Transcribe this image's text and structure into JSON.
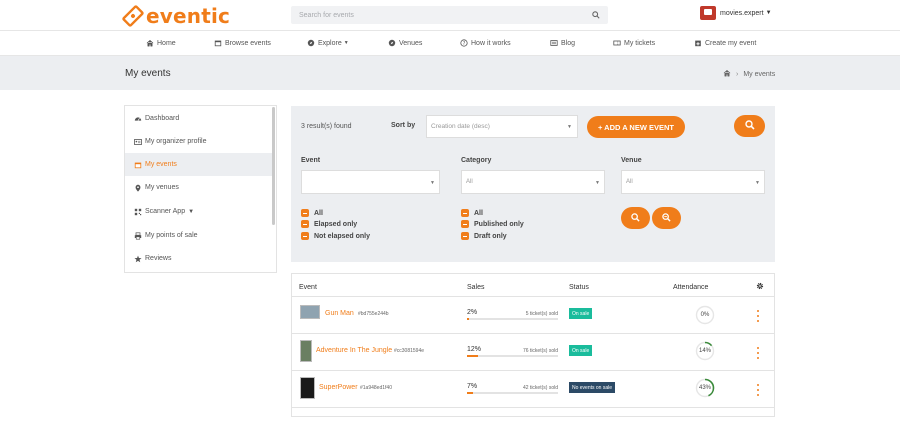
{
  "header": {
    "logo_text": "eventic",
    "search_placeholder": "Search for events",
    "user_name": "movies.expert"
  },
  "nav": [
    {
      "label": "Home",
      "icon": "home-icon"
    },
    {
      "label": "Browse events",
      "icon": "calendar-icon"
    },
    {
      "label": "Explore",
      "icon": "compass-icon"
    },
    {
      "label": "Venues",
      "icon": "compass-icon"
    },
    {
      "label": "How it works",
      "icon": "question-icon"
    },
    {
      "label": "Blog",
      "icon": "newspaper-icon"
    },
    {
      "label": "My tickets",
      "icon": "ticket-icon"
    },
    {
      "label": "Create my event",
      "icon": "calendar-plus-icon"
    }
  ],
  "page": {
    "title": "My events",
    "breadcrumb_current": "My events"
  },
  "sidebar": {
    "items": [
      {
        "label": "Dashboard",
        "icon": "dashboard-icon"
      },
      {
        "label": "My organizer profile",
        "icon": "id-card-icon"
      },
      {
        "label": "My events",
        "icon": "calendar-icon",
        "active": true
      },
      {
        "label": "My venues",
        "icon": "map-marker-icon"
      },
      {
        "label": "Scanner App",
        "icon": "qrcode-icon"
      },
      {
        "label": "My points of sale",
        "icon": "print-icon"
      },
      {
        "label": "Reviews",
        "icon": "star-icon"
      }
    ]
  },
  "filters": {
    "results_text": "3 result(s) found",
    "sort_label": "Sort by",
    "sort_value": "Creation date (desc)",
    "add_button": "+ ADD A NEW EVENT",
    "event_label": "Event",
    "category_label": "Category",
    "category_value": "All",
    "venue_label": "Venue",
    "venue_value": "All",
    "date_options": [
      "All",
      "Elapsed only",
      "Not elapsed only"
    ],
    "publish_options": [
      "All",
      "Published only",
      "Draft only"
    ]
  },
  "table": {
    "headers": {
      "event": "Event",
      "sales": "Sales",
      "status": "Status",
      "attendance": "Attendance"
    },
    "rows": [
      {
        "name": "Gun Man",
        "ref": "#bd755e244b",
        "sales_pct": "2%",
        "sales_value": 0.02,
        "sold": "5 ticket(s) sold",
        "status": "On sale",
        "status_kind": "on",
        "attendance": "0%",
        "attendance_value": 0
      },
      {
        "name": "Adventure In The Jungle",
        "ref": "#cc3081594e",
        "sales_pct": "12%",
        "sales_value": 0.12,
        "sold": "76 ticket(s) sold",
        "status": "On sale",
        "status_kind": "on",
        "attendance": "14%",
        "attendance_value": 0.14
      },
      {
        "name": "SuperPower",
        "ref": "#1a948ed1f40",
        "sales_pct": "7%",
        "sales_value": 0.07,
        "sold": "42 ticket(s) sold",
        "status": "No events on sale",
        "status_kind": "none",
        "attendance": "43%",
        "attendance_value": 0.43
      }
    ]
  },
  "colors": {
    "accent": "#f07d1a",
    "on_sale": "#1abc9c",
    "no_sale": "#2c4a66",
    "gauge": "#3a8a3a"
  }
}
